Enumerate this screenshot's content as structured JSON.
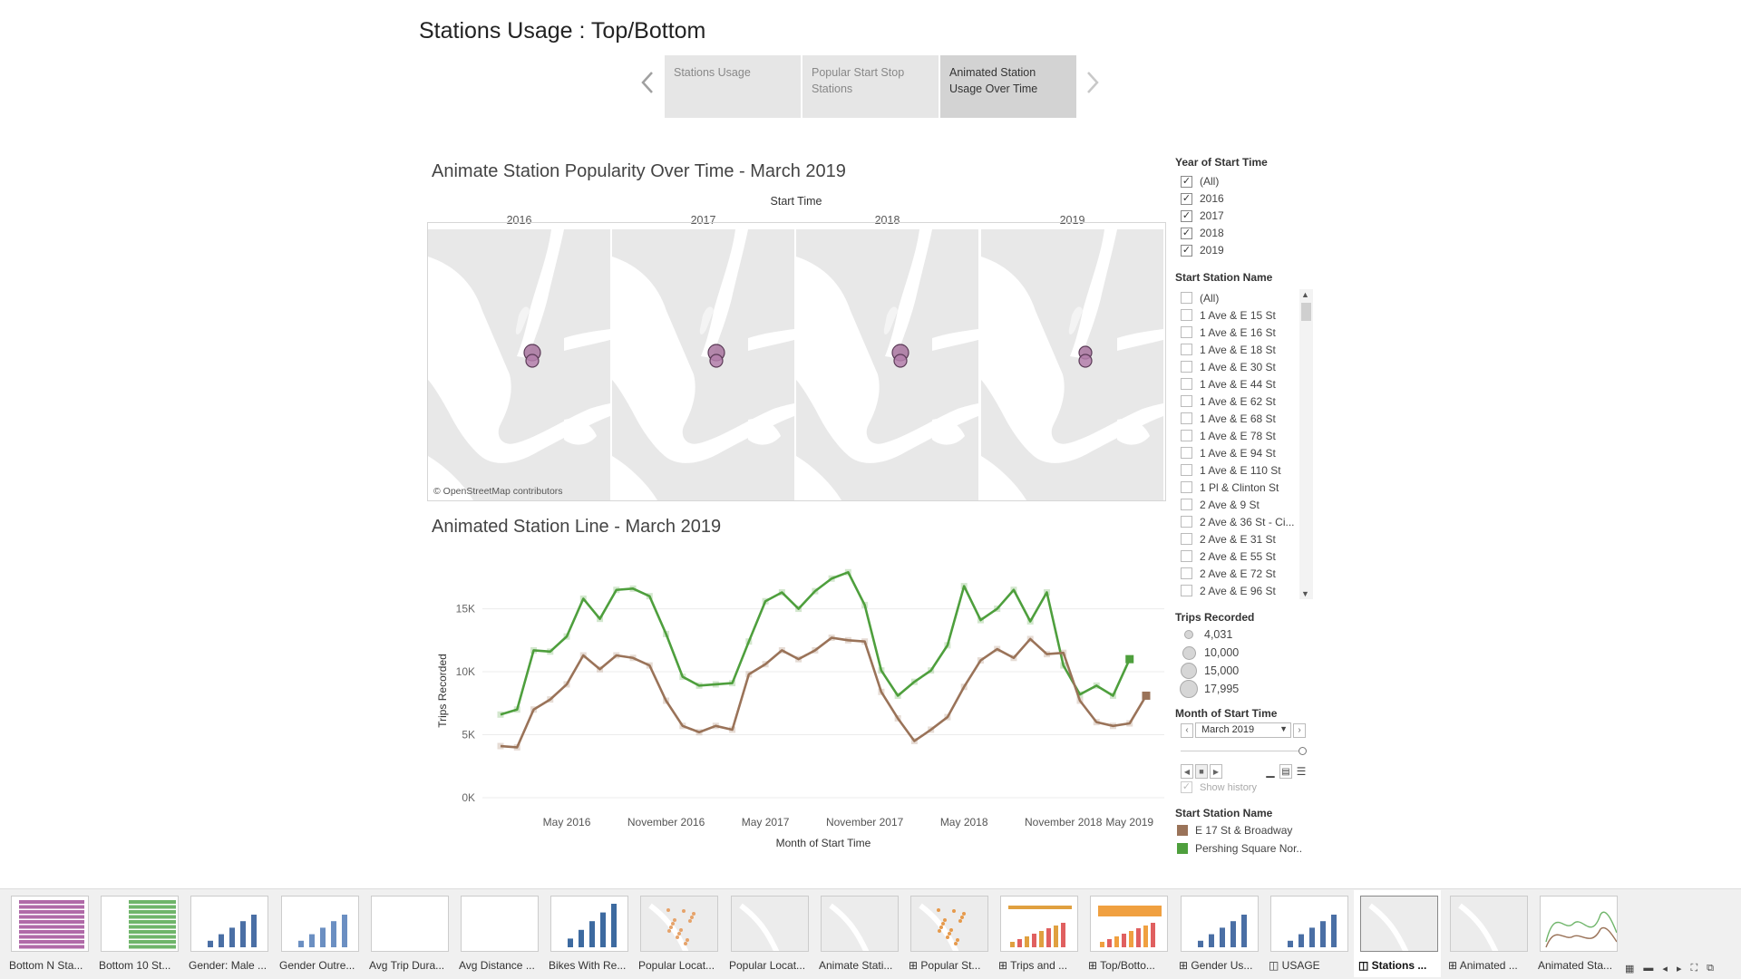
{
  "story": {
    "title": "Stations Usage : Top/Bottom",
    "points": [
      {
        "label": "Stations Usage",
        "active": false
      },
      {
        "label": "Popular Start  Stop Stations",
        "active": false
      },
      {
        "label": "Animated Station Usage Over Time",
        "active": true
      }
    ],
    "prev_icon": "chevron-left-icon",
    "next_icon": "chevron-right-icon"
  },
  "map_sheet": {
    "title": "Animate Station Popularity Over Time - March 2019",
    "column_header": "Start Time",
    "years": [
      "2016",
      "2017",
      "2018",
      "2019"
    ],
    "attribution": "© OpenStreetMap contributors"
  },
  "line_sheet": {
    "title": "Animated Station Line - March 2019"
  },
  "chart_data": {
    "type": "line",
    "xlabel": "Month of Start Time",
    "ylabel": "Trips Recorded",
    "ylim": [
      0,
      19000
    ],
    "y_ticks": [
      "0K",
      "5K",
      "10K",
      "15K"
    ],
    "y_tick_values": [
      0,
      5000,
      10000,
      15000
    ],
    "x_tick_labels": [
      "May 2016",
      "November 2016",
      "May 2017",
      "November 2017",
      "May 2018",
      "November 2018",
      "May 2019"
    ],
    "x_tick_months": [
      4,
      10,
      16,
      22,
      28,
      34,
      38
    ],
    "x_start": "Jan 2016",
    "series": [
      {
        "name": "Pershing Square Nor..",
        "color": "#4e9f3d",
        "values": [
          6600,
          7000,
          11700,
          11600,
          12800,
          15800,
          14200,
          16500,
          16600,
          16000,
          13000,
          9600,
          8900,
          9000,
          9100,
          12400,
          15600,
          16300,
          15000,
          16400,
          17400,
          17900,
          15300,
          10100,
          8100,
          9200,
          10100,
          12100,
          16800,
          14100,
          15000,
          16500,
          14000,
          16300,
          10500,
          8200,
          8900,
          8100,
          11000
        ]
      },
      {
        "name": "E 17 St & Broadway",
        "color": "#9a7359",
        "values": [
          4100,
          4000,
          7000,
          7800,
          9000,
          11300,
          10200,
          11300,
          11100,
          10500,
          7700,
          5700,
          5200,
          5700,
          5400,
          9800,
          10600,
          11700,
          11000,
          11700,
          12700,
          12500,
          12400,
          8400,
          6300,
          4500,
          5400,
          6400,
          8800,
          10900,
          11800,
          11100,
          12600,
          11400,
          11500,
          7700,
          6000,
          5700,
          5900,
          8100
        ]
      }
    ]
  },
  "filters": {
    "year": {
      "title": "Year of Start Time",
      "items": [
        {
          "label": "(All)",
          "checked": true
        },
        {
          "label": "2016",
          "checked": true
        },
        {
          "label": "2017",
          "checked": true
        },
        {
          "label": "2018",
          "checked": true
        },
        {
          "label": "2019",
          "checked": true
        }
      ]
    },
    "station": {
      "title": "Start Station Name",
      "items": [
        "(All)",
        "1 Ave & E 15 St",
        "1 Ave & E 16 St",
        "1 Ave & E 18 St",
        "1 Ave & E 30 St",
        "1 Ave & E 44 St",
        "1 Ave & E 62 St",
        "1 Ave & E 68 St",
        "1 Ave & E 78 St",
        "1 Ave & E 94 St",
        "1 Ave & E 110 St",
        "1 Pl & Clinton St",
        "2 Ave & 9 St",
        "2 Ave & 36 St - Ci...",
        "2 Ave & E 31 St",
        "2 Ave & E 55 St",
        "2 Ave & E 72 St",
        "2 Ave & E 96 St"
      ]
    },
    "size_legend": {
      "title": "Trips Recorded",
      "items": [
        "4,031",
        "10,000",
        "15,000",
        "17,995"
      ]
    },
    "month": {
      "title": "Month of Start Time",
      "value": "March 2019",
      "show_history": "Show history"
    },
    "color_legend": {
      "title": "Start Station Name",
      "items": [
        {
          "label": "E 17 St & Broadway",
          "color": "#9a7359"
        },
        {
          "label": "Pershing Square Nor..",
          "color": "#4e9f3d"
        }
      ]
    }
  },
  "tabs": [
    {
      "label": "Bottom N Sta...",
      "active": false
    },
    {
      "label": "Bottom 10 St...",
      "active": false
    },
    {
      "label": "Gender: Male ...",
      "active": false
    },
    {
      "label": "Gender Outre...",
      "active": false
    },
    {
      "label": "Avg Trip Dura...",
      "active": false
    },
    {
      "label": "Avg Distance ...",
      "active": false
    },
    {
      "label": "Bikes With Re...",
      "active": false
    },
    {
      "label": "Popular Locat...",
      "active": false
    },
    {
      "label": "Popular Locat...",
      "active": false
    },
    {
      "label": "Animate Stati...",
      "active": false
    },
    {
      "label": "⊞ Popular St...",
      "active": false
    },
    {
      "label": "⊞ Trips and ...",
      "active": false
    },
    {
      "label": "⊞ Top/Botto...",
      "active": false
    },
    {
      "label": "⊞ Gender Us...",
      "active": false
    },
    {
      "label": "◫ USAGE",
      "active": false
    },
    {
      "label": "◫ Stations ...",
      "active": true
    },
    {
      "label": "⊞ Animated ...",
      "active": false
    },
    {
      "label": "Animated Sta...",
      "active": false
    }
  ]
}
